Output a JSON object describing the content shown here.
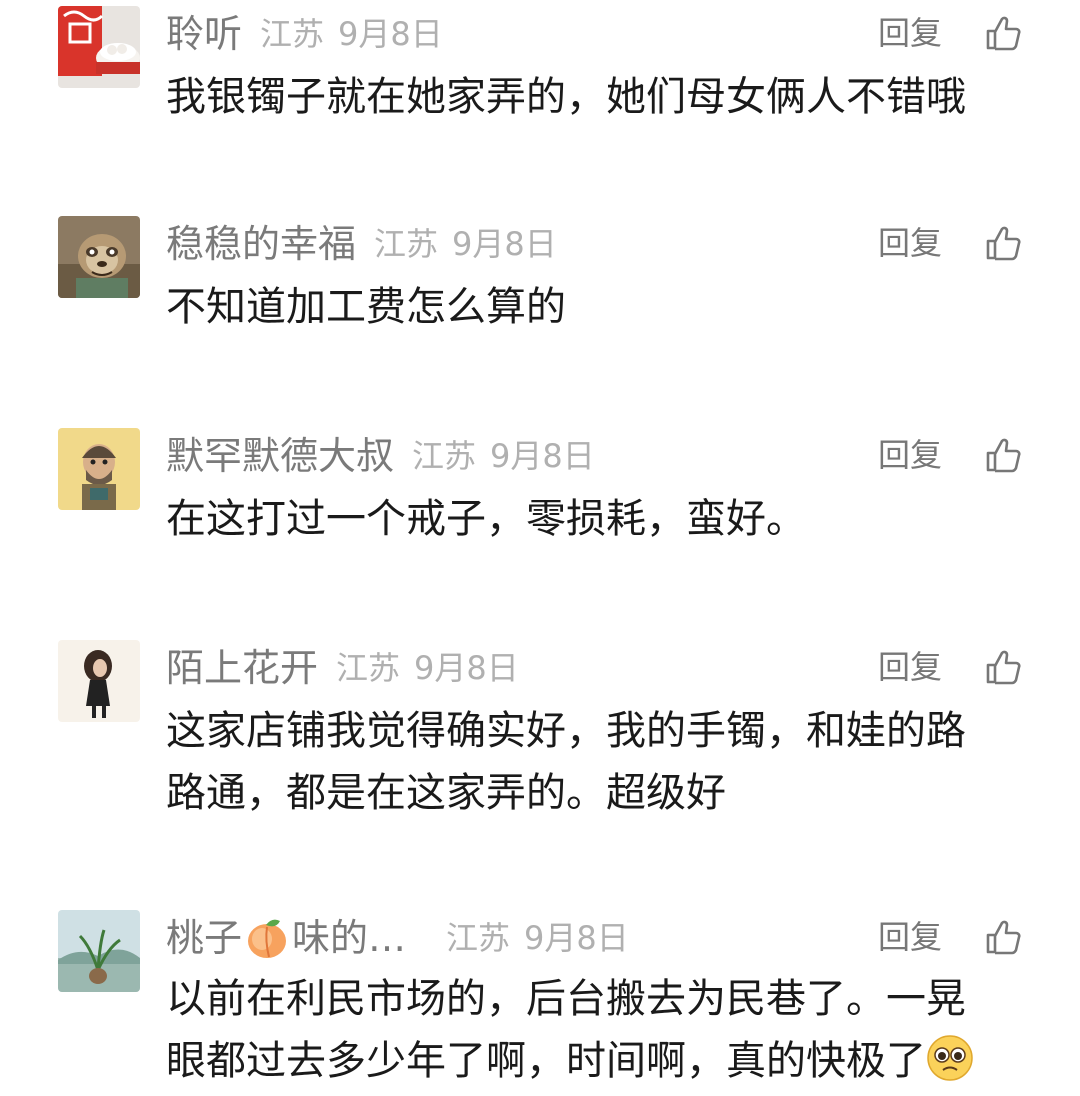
{
  "comments": [
    {
      "username": "聆听",
      "region": "江苏",
      "date": "9月8日",
      "reply_label": "回复",
      "text": "我银镯子就在她家弄的，她们母女俩人不错哦"
    },
    {
      "username": "稳稳的幸福",
      "region": "江苏",
      "date": "9月8日",
      "reply_label": "回复",
      "text": "不知道加工费怎么算的"
    },
    {
      "username": "默罕默德大叔",
      "region": "江苏",
      "date": "9月8日",
      "reply_label": "回复",
      "text": "在这打过一个戒子，零损耗，蛮好。"
    },
    {
      "username": "陌上花开",
      "region": "江苏",
      "date": "9月8日",
      "reply_label": "回复",
      "text": "这家店铺我觉得确实好，我的手镯，和娃的路路通，都是在这家弄的。超级好"
    },
    {
      "username": "桃子",
      "username_suffix": "味的…",
      "region": "江苏",
      "date": "9月8日",
      "reply_label": "回复",
      "text": "以前在利民市场的，后台搬去为民巷了。一晃眼都过去多少年了啊，时间啊，真的快极了"
    }
  ],
  "icons": {
    "like": "thumbs-up-icon",
    "peach": "peach-emoji-icon",
    "face": "pleading-face-emoji-icon"
  },
  "colors": {
    "username": "#7a7a7a",
    "meta": "#b0b0b0",
    "text": "#1a1a1a"
  }
}
